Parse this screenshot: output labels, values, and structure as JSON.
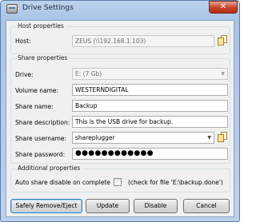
{
  "window": {
    "title": "Drive Settings",
    "close_glyph": "✕"
  },
  "host": {
    "group_title": "Host properties",
    "host_label": "Host:",
    "host_value": "ZEUS (\\\\192.168.1.103)"
  },
  "share": {
    "group_title": "Share properties",
    "drive_label": "Drive:",
    "drive_value": "E:  (7 Gb)",
    "volume_label": "Volume name:",
    "volume_value": "WESTERNDIGITAL",
    "sharename_label": "Share name:",
    "sharename_value": "Backup",
    "desc_label": "Share description:",
    "desc_value": "This is the USB drive for backup.",
    "user_label": "Share username:",
    "user_value": "shareplugger",
    "pass_label": "Share password:",
    "pass_value": "●●●●●●●●●●●●"
  },
  "additional": {
    "group_title": "Additional properties",
    "auto_label": "Auto share disable on complete",
    "auto_checked": false,
    "hint": "(check for file 'E:\\backup.done')"
  },
  "buttons": {
    "eject": "Safely Remove/Eject",
    "update": "Update",
    "disable": "Disable",
    "cancel": "Cancel"
  }
}
